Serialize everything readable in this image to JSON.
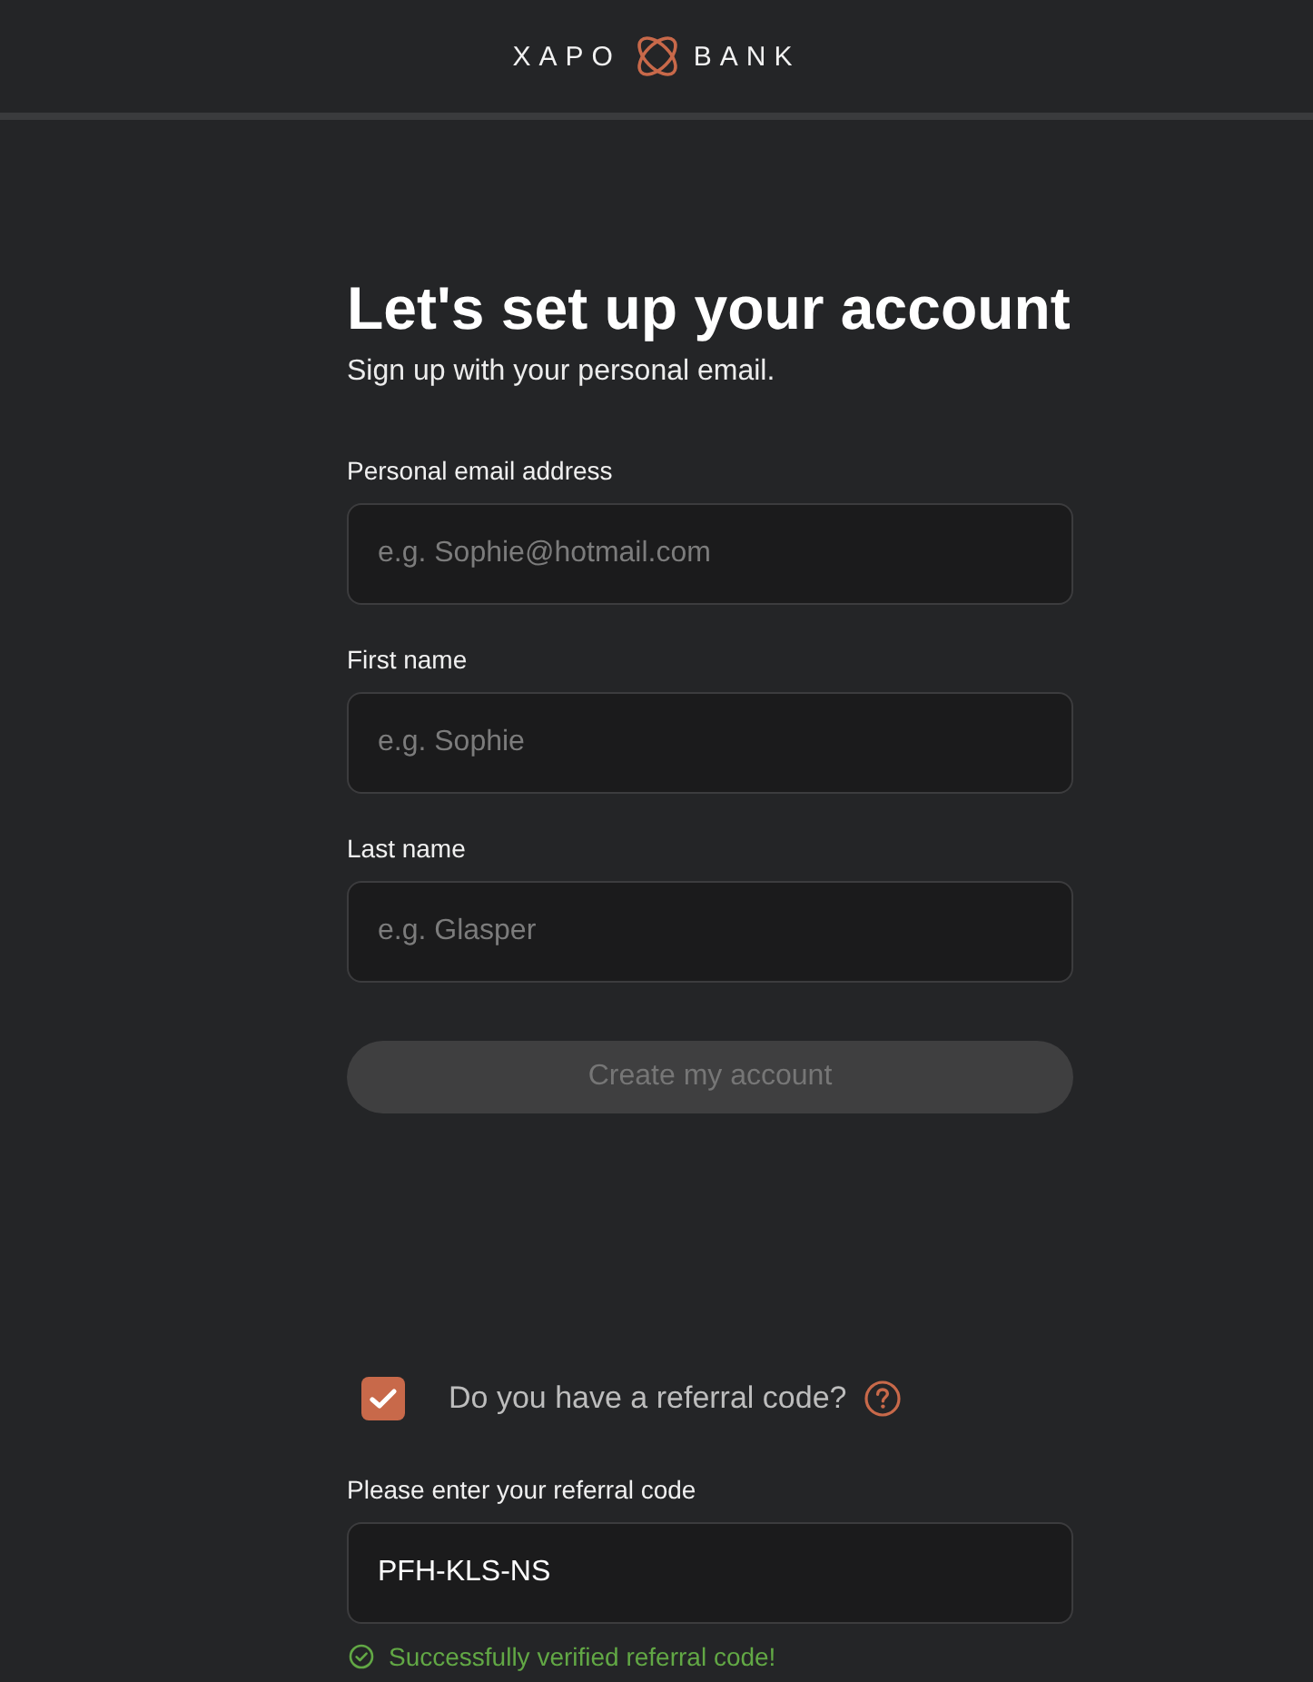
{
  "header": {
    "brand_left": "XAPO",
    "brand_right": "BANK"
  },
  "title": "Let's set up your account",
  "subtitle": "Sign up with your personal email.",
  "fields": [
    {
      "label": "Personal email address",
      "placeholder": "e.g. Sophie@hotmail.com"
    },
    {
      "label": "First name",
      "placeholder": "e.g. Sophie"
    },
    {
      "label": "Last name",
      "placeholder": "e.g. Glasper"
    }
  ],
  "submit": {
    "label": "Create my account",
    "disabled": true
  },
  "referral": {
    "checkbox": {
      "label": "Do you have a referral code?",
      "checked": true
    },
    "field": {
      "label": "Please enter your referral code",
      "value": "PFH-KLS-NS"
    },
    "status": {
      "kind": "success",
      "text": "Successfully verified referral code!"
    }
  }
}
